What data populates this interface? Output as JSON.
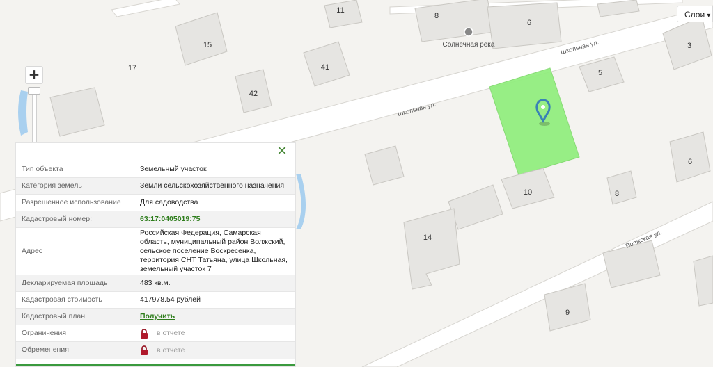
{
  "map": {
    "building_numbers": [
      "11",
      "8",
      "6",
      "15",
      "17",
      "41",
      "42",
      "5",
      "3",
      "10",
      "8",
      "6",
      "14",
      "9"
    ],
    "street_labels": [
      "Школьная ул.",
      "Школьная ул.",
      "Волжская ул."
    ],
    "poi_label": "Солнечная река",
    "parcel_color": "#90ee7c",
    "marker_color": "#3a83b5"
  },
  "controls": {
    "zoom_in_label": "+",
    "layers_label": "Слои"
  },
  "panel": {
    "close_label": "✕",
    "rows": [
      {
        "key": "Тип объекта",
        "value": "Земельный участок"
      },
      {
        "key": "Категория земель",
        "value": "Земли сельскохозяйственного назначения"
      },
      {
        "key": "Разрешенное использование",
        "value": "Для садоводства"
      },
      {
        "key": "Кадастровый номер:",
        "value": "63:17:0405019:75"
      },
      {
        "key": "Адрес",
        "value": "Российская Федерация, Самарская область, муниципальный район Волжский, сельское поселение Воскресенка, территория СНТ Татьяна, улица Школьная, земельный участок 7"
      },
      {
        "key": "Декларируемая площадь",
        "value": "483 кв.м."
      },
      {
        "key": "Кадастровая стоимость",
        "value": "417978.54 рублей"
      },
      {
        "key": "Кадастровый план",
        "value": "Получить"
      },
      {
        "key": "Ограничения",
        "value": "в отчете"
      },
      {
        "key": "Обременения",
        "value": "в отчете"
      }
    ]
  }
}
